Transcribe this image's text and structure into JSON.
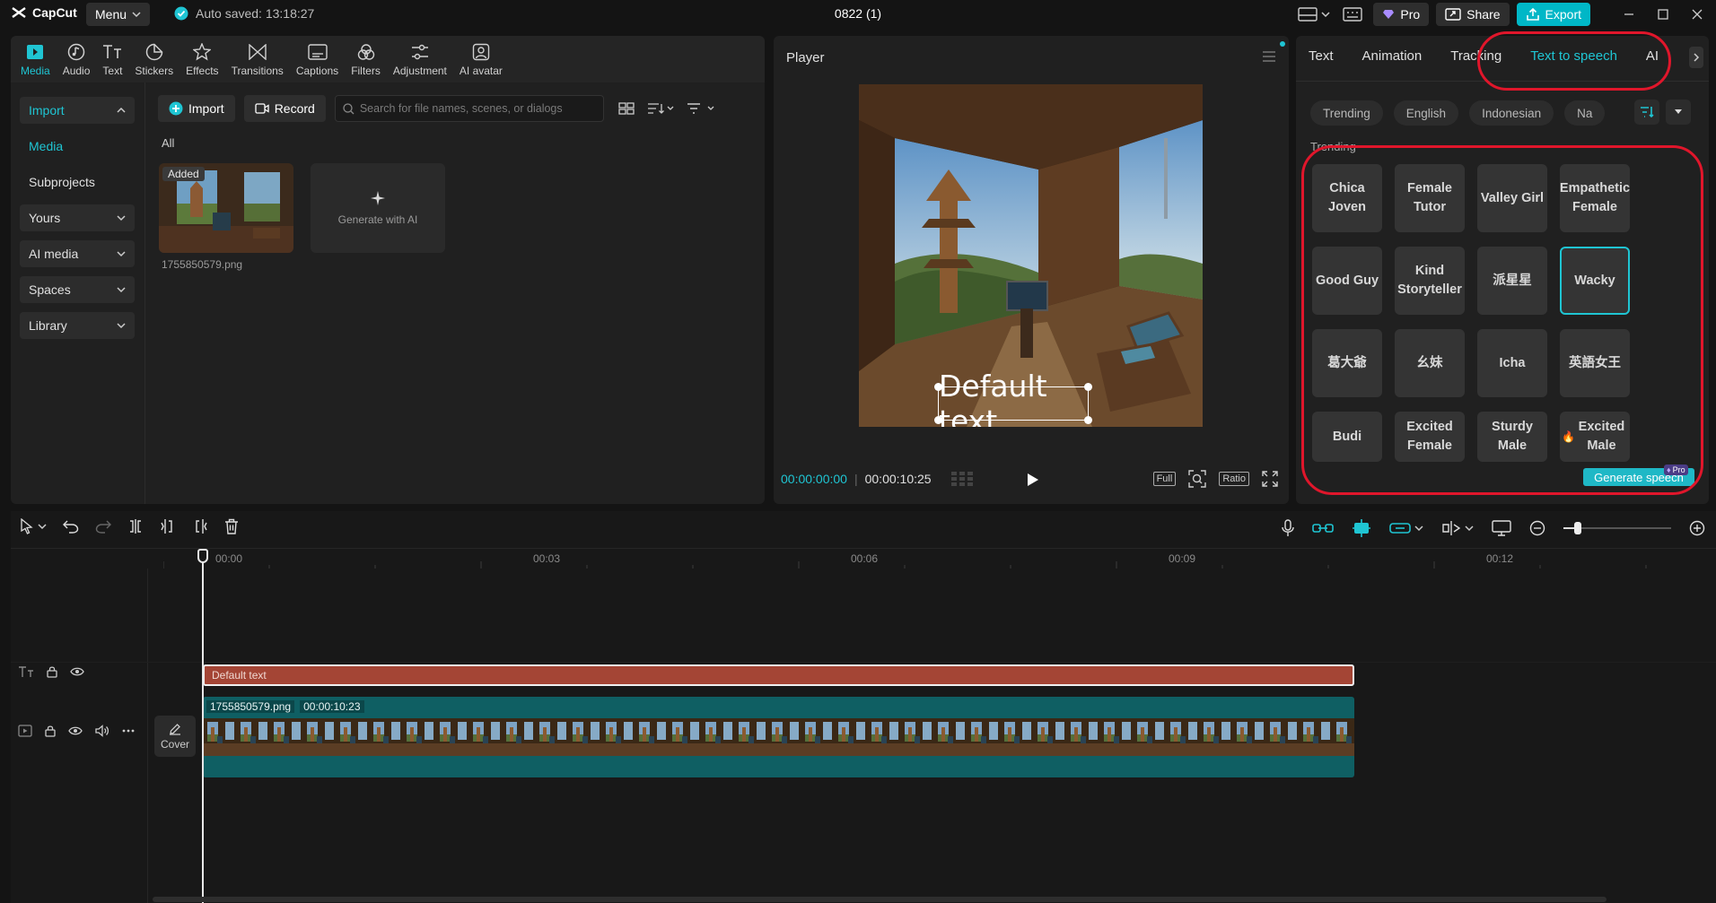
{
  "titlebar": {
    "app_name": "CapCut",
    "menu_label": "Menu",
    "autosave": "Auto saved: 13:18:27",
    "project_title": "0822 (1)",
    "pro_label": "Pro",
    "share_label": "Share",
    "export_label": "Export"
  },
  "toolbar": {
    "tools": [
      {
        "label": "Media",
        "icon": "media-icon"
      },
      {
        "label": "Audio",
        "icon": "audio-icon"
      },
      {
        "label": "Text",
        "icon": "text-icon"
      },
      {
        "label": "Stickers",
        "icon": "stickers-icon"
      },
      {
        "label": "Effects",
        "icon": "effects-icon"
      },
      {
        "label": "Transitions",
        "icon": "transitions-icon"
      },
      {
        "label": "Captions",
        "icon": "captions-icon"
      },
      {
        "label": "Filters",
        "icon": "filters-icon"
      },
      {
        "label": "Adjustment",
        "icon": "adjustment-icon"
      },
      {
        "label": "AI avatar",
        "icon": "ai-avatar-icon"
      }
    ]
  },
  "leftnav": {
    "import": "Import",
    "media": "Media",
    "subprojects": "Subprojects",
    "yours": "Yours",
    "ai_media": "AI media",
    "spaces": "Spaces",
    "library": "Library"
  },
  "media": {
    "import_btn": "Import",
    "record_btn": "Record",
    "search_placeholder": "Search for file names, scenes, or dialogs",
    "filter_all": "All",
    "added_badge": "Added",
    "file_name": "1755850579.png",
    "generate_ai": "Generate with AI"
  },
  "player": {
    "title": "Player",
    "overlay_text": "Default text",
    "current_time": "00:00:00:00",
    "total_time": "00:00:10:25",
    "full_label": "Full",
    "ratio_label": "Ratio"
  },
  "rightpanel": {
    "tabs": [
      "Text",
      "Animation",
      "Tracking",
      "Text to speech",
      "AI"
    ],
    "chips": [
      "Trending",
      "English",
      "Indonesian",
      "Na"
    ],
    "section_label": "Trending",
    "voices": [
      [
        "Chica Joven",
        "Female Tutor",
        "Valley Girl",
        "Empathetic Female"
      ],
      [
        "Good Guy",
        "Kind Storyteller",
        "派星星",
        "Wacky"
      ],
      [
        "葛大爺",
        "幺妹",
        "Icha",
        "英語女王"
      ],
      [
        "Budi",
        "Excited Female",
        "Sturdy Male",
        "Excited Male"
      ]
    ],
    "pro_badge": "Pro",
    "generate_btn": "Generate speech"
  },
  "timeline": {
    "ruler": [
      "00:00",
      "00:03",
      "00:06",
      "00:09",
      "00:12"
    ],
    "text_clip": "Default text",
    "video_clip_name": "1755850579.png",
    "video_clip_duration": "00:00:10:23",
    "cover_label": "Cover",
    "playhead": 0
  },
  "colors": {
    "accent": "#1fc5d3",
    "export": "#00b7c7",
    "annotation": "#e0162b",
    "text_clip": "#a44535",
    "video_clip": "#0f5f63"
  }
}
